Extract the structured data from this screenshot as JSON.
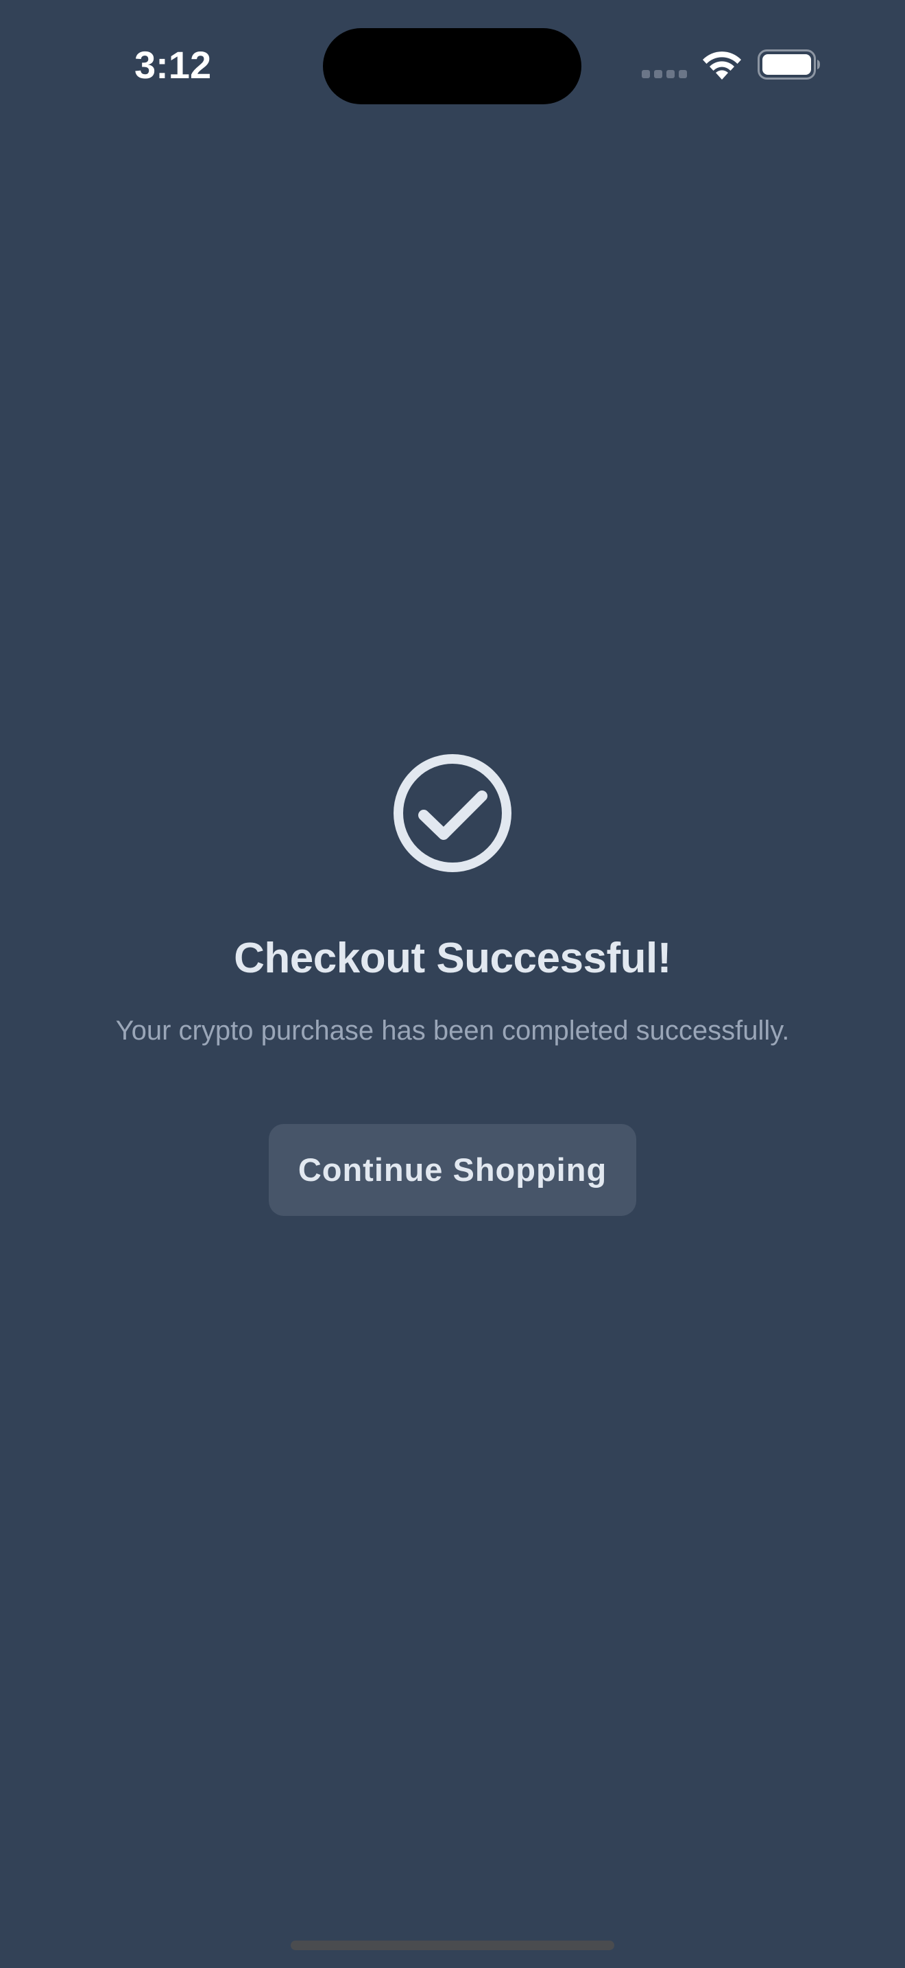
{
  "status_bar": {
    "time": "3:12",
    "icons": [
      "cellular-signal-icon",
      "wifi-icon",
      "battery-icon"
    ]
  },
  "content": {
    "icon": "check-circle-icon",
    "title": "Checkout Successful!",
    "subtitle": "Your crypto purchase has been completed successfully.",
    "button_label": "Continue Shopping"
  },
  "colors": {
    "background": "#334257",
    "title_text": "#e2e8f0",
    "subtitle_text": "#9aa6b8",
    "button_background": "#475569",
    "icon": "#e2e8f0"
  }
}
